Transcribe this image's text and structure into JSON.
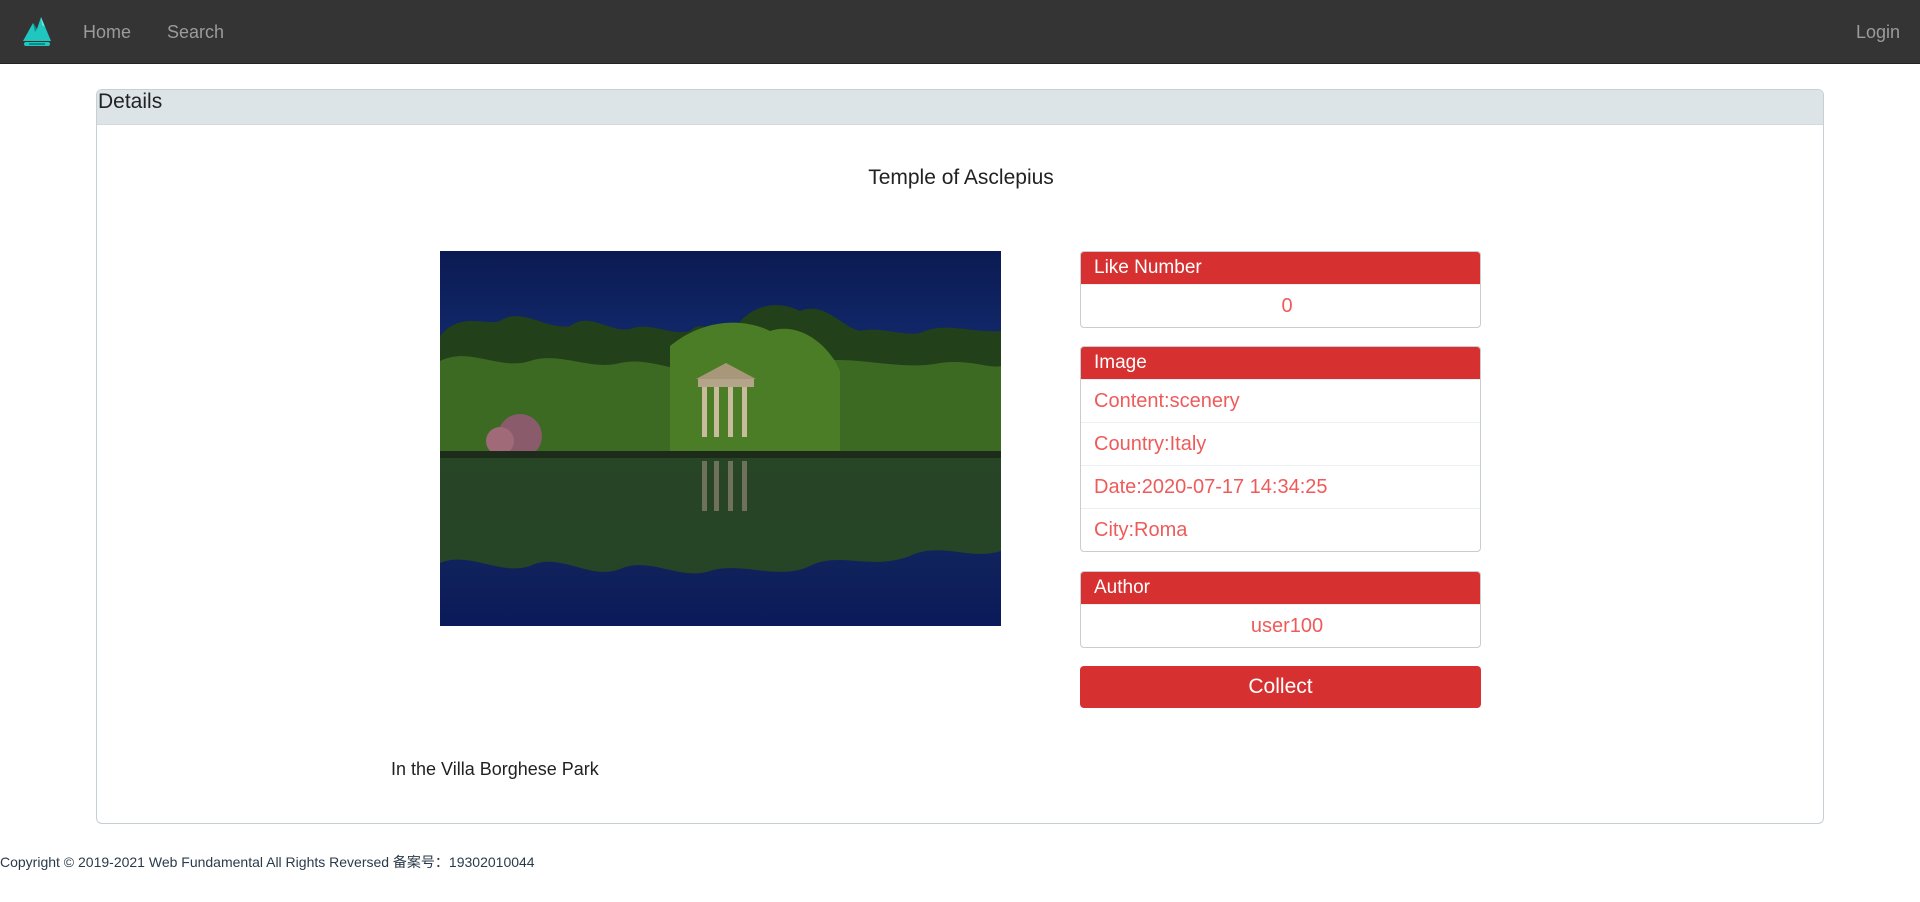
{
  "nav": {
    "home_label": "Home",
    "search_label": "Search",
    "login_label": "Login",
    "logo_icon": "mountain-logo-icon",
    "logo_color": "#1fc7c0"
  },
  "card": {
    "header": "Details",
    "title": "Temple of Asclepius",
    "description": "In the Villa Borghese Park"
  },
  "like_panel": {
    "header": "Like Number",
    "value": "0"
  },
  "image_panel": {
    "header": "Image",
    "rows": [
      "Content:scenery",
      "Country:Italy",
      "Date:2020-07-17 14:34:25",
      "City:Roma"
    ]
  },
  "author_panel": {
    "header": "Author",
    "value": "user100"
  },
  "collect_button": "Collect",
  "footer": "Copyright © 2019-2021 Web Fundamental All Rights Reversed 备案号：19302010044",
  "colors": {
    "accent": "#d63031",
    "accent_text": "#ef5a5a",
    "navbar_bg": "#343434",
    "header_bg": "#dde4e8"
  }
}
